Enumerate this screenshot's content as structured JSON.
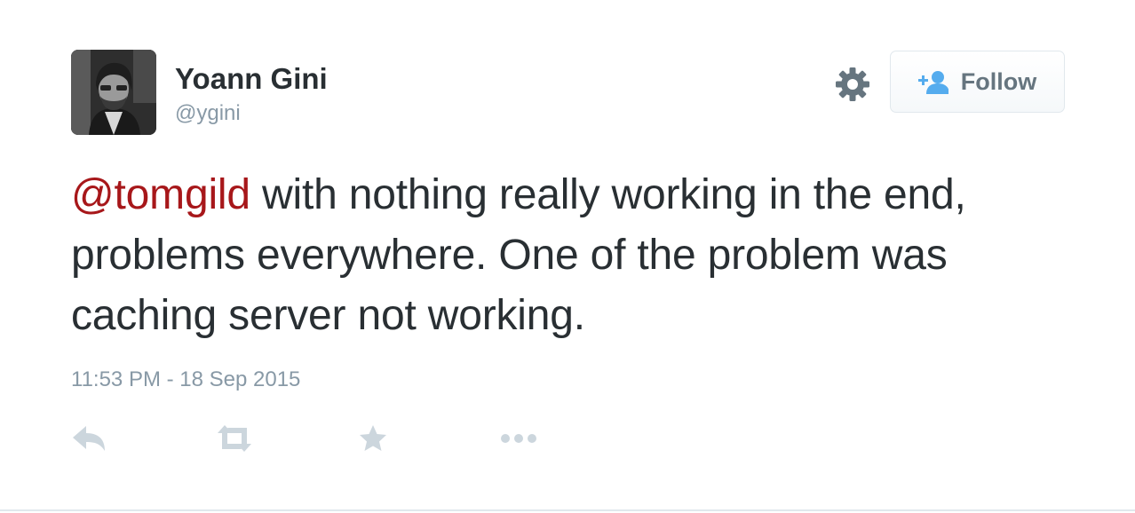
{
  "author": {
    "name": "Yoann Gini",
    "handle": "@ygini",
    "avatar_icon": "user-photo"
  },
  "settings": {
    "icon": "gear-icon"
  },
  "follow_button": {
    "label": "Follow",
    "icon": "add-user-icon"
  },
  "tweet": {
    "mention": "@tomgild",
    "body": " with nothing really working in the end, problems everywhere. One of the problem was caching server not working.",
    "timestamp": "11:53 PM - 18 Sep 2015"
  },
  "actions": [
    {
      "name": "reply",
      "icon": "reply-icon"
    },
    {
      "name": "retweet",
      "icon": "retweet-icon"
    },
    {
      "name": "favorite",
      "icon": "star-icon"
    },
    {
      "name": "more",
      "icon": "more-icon"
    }
  ],
  "colors": {
    "mention": "#a7171a",
    "text": "#292f33",
    "muted": "#8899a6",
    "follow_blue": "#55acee",
    "action_gray": "#ccd6dd"
  }
}
